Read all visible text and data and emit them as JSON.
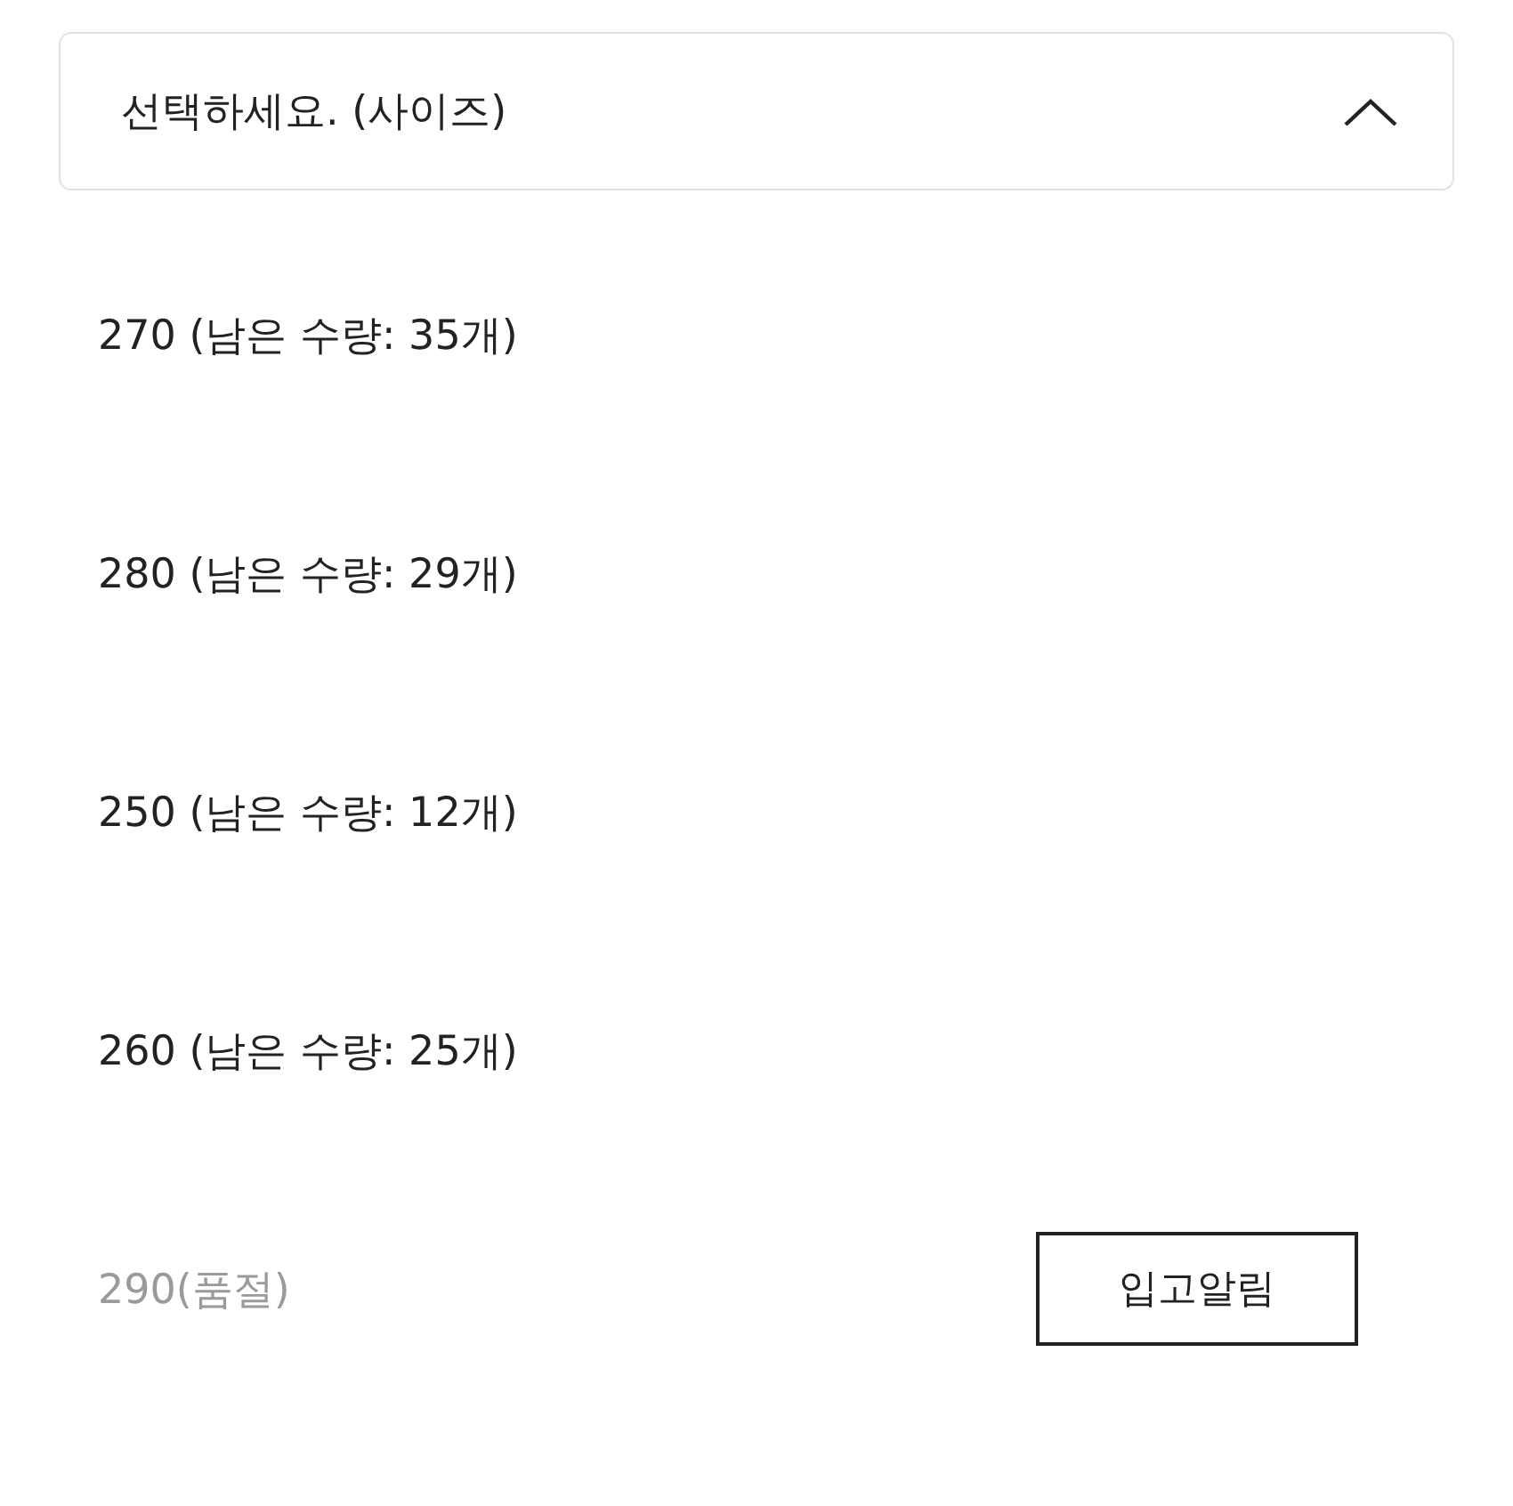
{
  "size_select": {
    "label": "선택하세요. (사이즈)",
    "expanded": true
  },
  "options": [
    {
      "label": "270 (남은 수량: 35개)",
      "kind": "available"
    },
    {
      "label": "280 (남은 수량: 29개)",
      "kind": "available"
    },
    {
      "label": "250 (남은 수량: 12개)",
      "kind": "available"
    },
    {
      "label": "260 (남은 수량: 25개)",
      "kind": "available"
    },
    {
      "label": "290(품절)",
      "kind": "sold_out",
      "button": "입고알림"
    }
  ]
}
